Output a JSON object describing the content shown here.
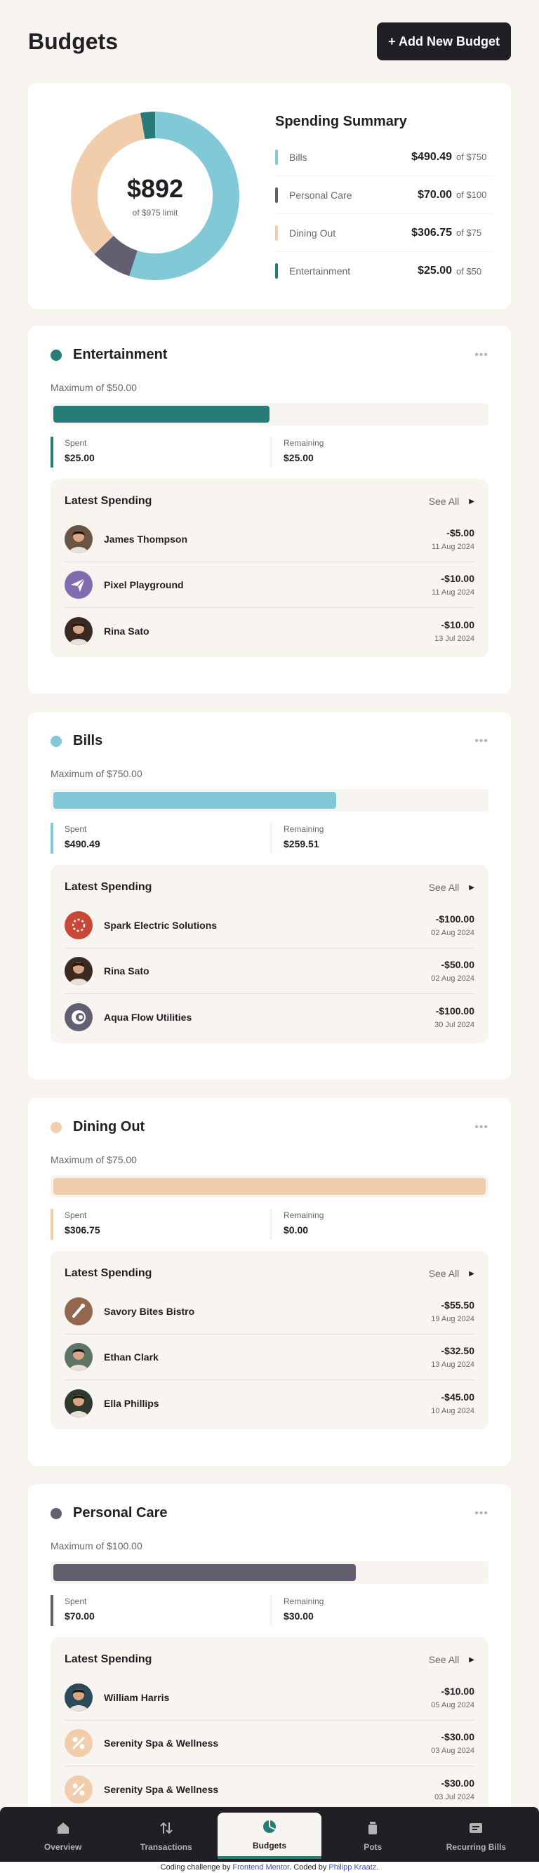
{
  "page_title": "Budgets",
  "add_button": "+ Add New Budget",
  "summary": {
    "total": "$892",
    "limit": "of $975 limit",
    "title": "Spending Summary",
    "rows": [
      {
        "name": "Bills",
        "spent": "$490.49",
        "max": "of $750",
        "color": "#82C9D7"
      },
      {
        "name": "Personal Care",
        "spent": "$70.00",
        "max": "of $100",
        "color": "#626070"
      },
      {
        "name": "Dining Out",
        "spent": "$306.75",
        "max": "of $75",
        "color": "#F2CDAC"
      },
      {
        "name": "Entertainment",
        "spent": "$25.00",
        "max": "of $50",
        "color": "#277C78"
      }
    ],
    "donut": [
      {
        "name": "Bills",
        "value": 490.49,
        "color": "#82C9D7"
      },
      {
        "name": "Personal Care",
        "value": 70,
        "color": "#626070"
      },
      {
        "name": "Dining Out",
        "value": 306.75,
        "color": "#F2CDAC"
      },
      {
        "name": "Entertainment",
        "value": 25,
        "color": "#277C78"
      }
    ]
  },
  "budgets": [
    {
      "name": "Entertainment",
      "color": "#277C78",
      "maximum": "Maximum of $50.00",
      "progress": 0.5,
      "spent_label": "Spent",
      "spent": "$25.00",
      "remaining_label": "Remaining",
      "remaining": "$25.00",
      "latest_title": "Latest Spending",
      "see_all": "See All",
      "transactions": [
        {
          "name": "James Thompson",
          "amount": "-$5.00",
          "date": "11 Aug 2024",
          "avatar": "person",
          "avatar_color": "#6B5444"
        },
        {
          "name": "Pixel Playground",
          "amount": "-$10.00",
          "date": "11 Aug 2024",
          "avatar": "paper-plane-icon",
          "avatar_color": "#826CB0"
        },
        {
          "name": "Rina Sato",
          "amount": "-$10.00",
          "date": "13 Jul 2024",
          "avatar": "person",
          "avatar_color": "#3A2A22"
        }
      ]
    },
    {
      "name": "Bills",
      "color": "#82C9D7",
      "maximum": "Maximum of $750.00",
      "progress": 0.654,
      "spent_label": "Spent",
      "spent": "$490.49",
      "remaining_label": "Remaining",
      "remaining": "$259.51",
      "latest_title": "Latest Spending",
      "see_all": "See All",
      "transactions": [
        {
          "name": "Spark Electric Solutions",
          "amount": "-$100.00",
          "date": "02 Aug 2024",
          "avatar": "spark-icon",
          "avatar_color": "#C94736"
        },
        {
          "name": "Rina Sato",
          "amount": "-$50.00",
          "date": "02 Aug 2024",
          "avatar": "person",
          "avatar_color": "#3A2A22"
        },
        {
          "name": "Aqua Flow Utilities",
          "amount": "-$100.00",
          "date": "30 Jul 2024",
          "avatar": "aqua-icon",
          "avatar_color": "#626070"
        }
      ]
    },
    {
      "name": "Dining Out",
      "color": "#F2CDAC",
      "maximum": "Maximum of $75.00",
      "progress": 1,
      "spent_label": "Spent",
      "spent": "$306.75",
      "remaining_label": "Remaining",
      "remaining": "$0.00",
      "latest_title": "Latest Spending",
      "see_all": "See All",
      "transactions": [
        {
          "name": "Savory Bites Bistro",
          "amount": "-$55.50",
          "date": "19 Aug 2024",
          "avatar": "utensil-icon",
          "avatar_color": "#93674F"
        },
        {
          "name": "Ethan Clark",
          "amount": "-$32.50",
          "date": "13 Aug 2024",
          "avatar": "person",
          "avatar_color": "#5E7466"
        },
        {
          "name": "Ella Phillips",
          "amount": "-$45.00",
          "date": "10 Aug 2024",
          "avatar": "person",
          "avatar_color": "#2F3A2E"
        }
      ]
    },
    {
      "name": "Personal Care",
      "color": "#626070",
      "maximum": "Maximum of $100.00",
      "progress": 0.7,
      "spent_label": "Spent",
      "spent": "$70.00",
      "remaining_label": "Remaining",
      "remaining": "$30.00",
      "latest_title": "Latest Spending",
      "see_all": "See All",
      "transactions": [
        {
          "name": "William Harris",
          "amount": "-$10.00",
          "date": "05 Aug 2024",
          "avatar": "person",
          "avatar_color": "#2B4A5A"
        },
        {
          "name": "Serenity Spa & Wellness",
          "amount": "-$30.00",
          "date": "03 Aug 2024",
          "avatar": "percent-icon",
          "avatar_color": "#F2CDAC"
        },
        {
          "name": "Serenity Spa & Wellness",
          "amount": "-$30.00",
          "date": "03 Jul 2024",
          "avatar": "percent-icon",
          "avatar_color": "#F2CDAC"
        }
      ]
    }
  ],
  "nav": [
    {
      "label": "Overview",
      "icon": "home-icon",
      "active": false
    },
    {
      "label": "Transactions",
      "icon": "arrows-icon",
      "active": false
    },
    {
      "label": "Budgets",
      "icon": "pie-icon",
      "active": true
    },
    {
      "label": "Pots",
      "icon": "jar-icon",
      "active": false
    },
    {
      "label": "Recurring Bills",
      "icon": "receipt-icon",
      "active": false
    }
  ],
  "attribution": {
    "prefix": "Coding challenge by ",
    "fm": "Frontend Mentor",
    "mid": ". Coded by ",
    "author": "Philipp Kraatz",
    "suffix": "."
  }
}
